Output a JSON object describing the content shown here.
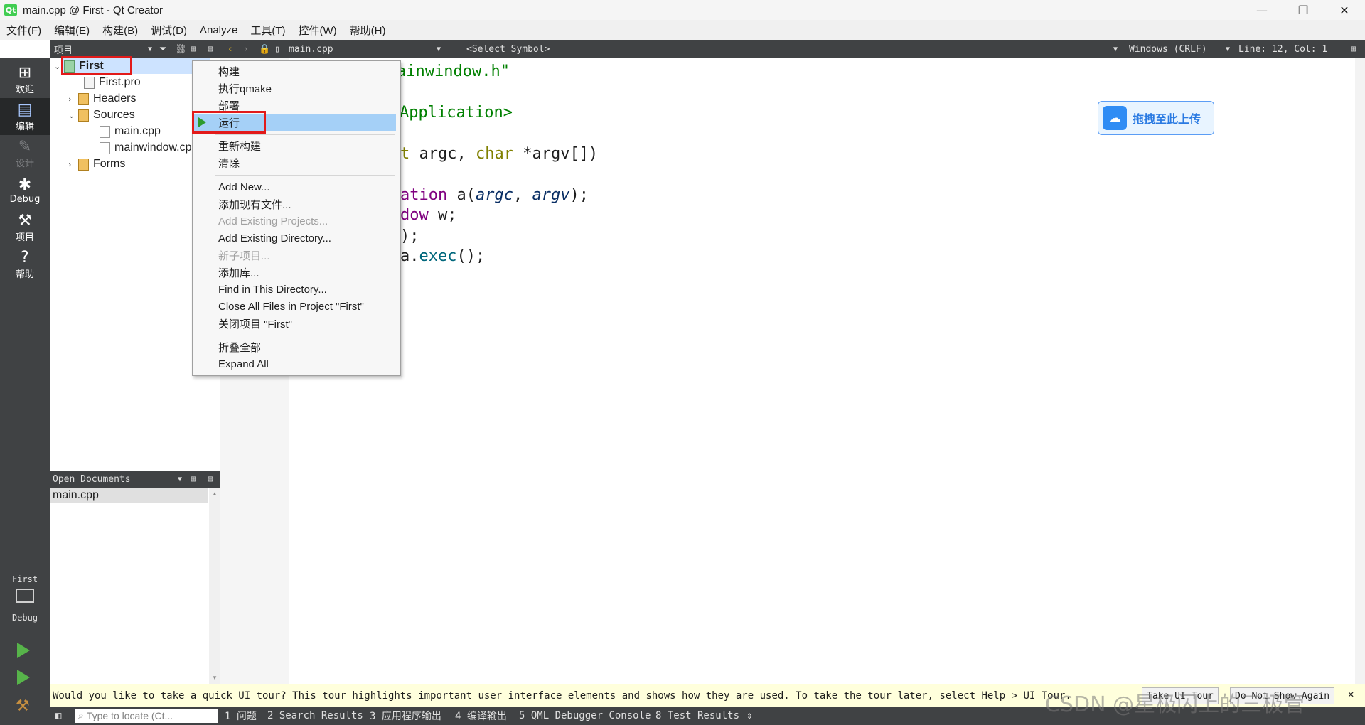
{
  "window": {
    "title": "main.cpp @ First - Qt Creator",
    "logo": "Qt",
    "controls": {
      "minimize": "—",
      "restore": "❐",
      "close": "✕"
    }
  },
  "menubar": [
    "文件(F)",
    "编辑(E)",
    "构建(B)",
    "调试(D)",
    "Analyze",
    "工具(T)",
    "控件(W)",
    "帮助(H)"
  ],
  "modes": [
    {
      "label": "欢迎",
      "icon": "grid-icon"
    },
    {
      "label": "编辑",
      "icon": "edit-icon"
    },
    {
      "label": "设计",
      "icon": "pencil-icon"
    },
    {
      "label": "Debug",
      "icon": "bug-icon"
    },
    {
      "label": "项目",
      "icon": "wrench-icon"
    },
    {
      "label": "帮助",
      "icon": "help-icon"
    }
  ],
  "kit": {
    "project": "First",
    "config": "Debug"
  },
  "project_pane": {
    "title": "项目",
    "tree": [
      {
        "label": "First"
      },
      {
        "label": "First.pro"
      },
      {
        "label": "Headers"
      },
      {
        "label": "Sources"
      },
      {
        "label": "main.cpp"
      },
      {
        "label": "mainwindow.cpp"
      },
      {
        "label": "Forms"
      }
    ]
  },
  "editor_toolbar": {
    "file": "main.cpp",
    "symbol": "<Select Symbol>",
    "line_ending": "Windows (CRLF)",
    "position": "Line: 12, Col: 1"
  },
  "code_lines": [
    {
      "text": "ainwindow.h\"",
      "color": "#008000"
    },
    {
      "text": "Application>",
      "color": "#008000"
    },
    {
      "text": "argc, char *argv[])"
    },
    {
      "text": "ation a(argc, argv);"
    },
    {
      "text": "dow w;"
    },
    {
      "text": ");"
    },
    {
      "text": "a.exec();"
    }
  ],
  "context_menu": {
    "items": [
      "构建",
      "执行qmake",
      "部署",
      "运行",
      "重新构建",
      "清除",
      "Add New...",
      "添加现有文件...",
      "Add Existing Projects...",
      "Add Existing Directory...",
      "新子项目...",
      "添加库...",
      "Find in This Directory...",
      "Close All Files in Project \"First\"",
      "关闭项目 \"First\"",
      "折叠全部",
      "Expand All"
    ]
  },
  "open_documents": {
    "title": "Open Documents",
    "files": [
      "main.cpp"
    ]
  },
  "baidu_button": {
    "label": "拖拽至此上传"
  },
  "tour": {
    "message": "Would you like to take a quick UI tour? This tour highlights important user interface elements and shows how they are used. To take the tour later, select Help > UI Tour.",
    "take_label": "Take UI Tour",
    "dismiss_label": "Do Not Show Again"
  },
  "statusbar": {
    "locate_placeholder": "Type to locate (Ct...",
    "panes": [
      "1 问题",
      "2 Search Results",
      "3 应用程序输出",
      "4 编译输出",
      "5 QML Debugger Console",
      "8 Test Results"
    ]
  },
  "watermark": "CSDN @星极闪上的三极管"
}
